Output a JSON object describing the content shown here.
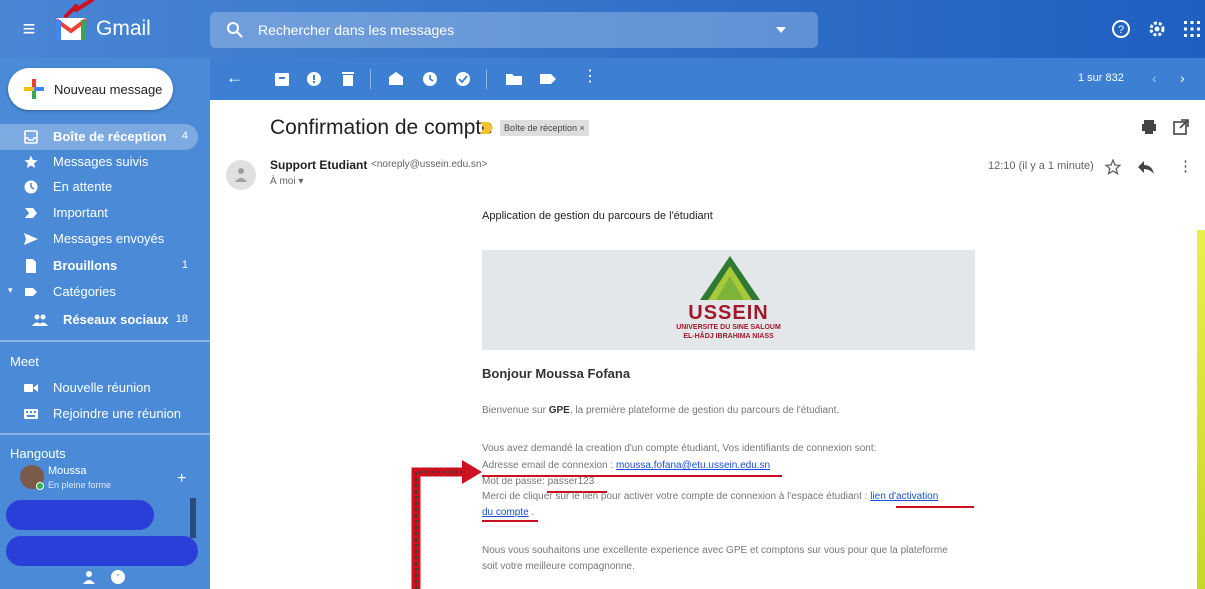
{
  "header": {
    "app_name": "Gmail",
    "search_placeholder": "Rechercher dans les messages"
  },
  "sidebar": {
    "compose_label": "Nouveau message",
    "items": [
      {
        "label": "Boîte de réception",
        "count": "4"
      },
      {
        "label": "Messages suivis",
        "count": ""
      },
      {
        "label": "En attente",
        "count": ""
      },
      {
        "label": "Important",
        "count": ""
      },
      {
        "label": "Messages envoyés",
        "count": ""
      },
      {
        "label": "Brouillons",
        "count": "1"
      },
      {
        "label": "Catégories",
        "count": ""
      },
      {
        "label": "Réseaux sociaux",
        "count": "18"
      }
    ],
    "meet": {
      "title": "Meet",
      "items": [
        {
          "label": "Nouvelle réunion"
        },
        {
          "label": "Rejoindre une réunion"
        }
      ]
    },
    "hangouts": {
      "title": "Hangouts",
      "user_name": "Moussa",
      "user_status": "En pleine forme"
    }
  },
  "toolbar": {
    "pager": "1 sur 832"
  },
  "message": {
    "subject": "Confirmation de compte",
    "label_chip": "Boîte de réception ×",
    "sender_name": "Support Etudiant",
    "sender_email": "<noreply@ussein.edu.sn>",
    "recipient": "À moi ▾",
    "time": "12:10 (il y a 1 minute)",
    "body": {
      "intro": "Application de gestion du parcours de l'étudiant",
      "banner": {
        "name": "USSEIN",
        "line1": "UNIVERSITE DU SINE SALOUM",
        "line2": "EL-HÂDJ IBRAHIMA NIASS"
      },
      "greeting": "Bonjour Moussa Fofana",
      "welcome_prefix": "Bienvenue sur ",
      "welcome_brand": "GPE",
      "welcome_suffix": ", la première plateforme de gestion du parcours de l'étudiant.",
      "credentials_intro": "Vous avez demandé la creation d'un compte étudiant, Vos identifiants de connexion sont:",
      "email_label": "Adresse email de connexion : ",
      "email_value": "moussa.fofana@etu.ussein.edu.sn",
      "password_line": "Mot de passe: passer123",
      "activation_text": "Merci de cliquer sur le lien pour activer votre compte de connexion à l'espace étudiant : ",
      "activation_link_1": "lien d'activation",
      "activation_link_2": "du compte",
      "activation_end": " .",
      "closing": "Nous vous souhaitons une excellente experience avec GPE et comptons sur vous pour que la plateforme soit votre meilleure compagnonne."
    }
  },
  "colors": {
    "header_blue": "#2f6fc8",
    "sidebar_blue": "#4a8ad6",
    "annotation_red": "#cc1020",
    "link_blue": "#1a4ed8",
    "ussein_red": "#a0182a"
  }
}
